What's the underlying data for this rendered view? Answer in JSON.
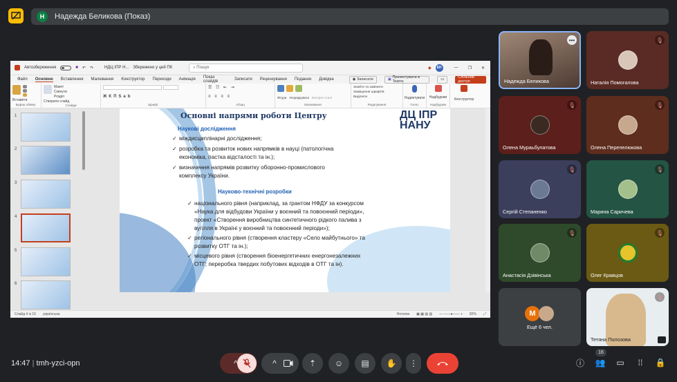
{
  "presenter": {
    "initial": "Н",
    "label": "Надежда Беликова (Показ)"
  },
  "ppt": {
    "autosave_label": "Автозбереження",
    "doc_name": "НДЦ ІПР Н...",
    "saved_label": "Збережено у цей ПК",
    "search_placeholder": "Пошук",
    "user_initials": "ЕН",
    "menu": [
      "Файл",
      "Основне",
      "Вставлення",
      "Малювання",
      "Конструктор",
      "Переходи",
      "Анімація",
      "Показ слайдів",
      "Записати",
      "Рецензування",
      "Подання",
      "Довідка"
    ],
    "record_btn": "Записати",
    "teams_btn": "Презентувати в Teams",
    "share_btn": "Спільний доступ",
    "ribbon": {
      "paste": "Вставити",
      "clipboard": "Буфер обміну",
      "new_slide": "Створити слайд",
      "slides": "Слайди",
      "layout": "Макет",
      "reset": "Скинути",
      "section": "Розділ",
      "font": "Шрифт",
      "paragraph": "Абзац",
      "shapes": "Фігури",
      "arrange": "Упорядкувати",
      "quick_styles": "Експрес-стилі",
      "drawing": "Малювання",
      "find": "Знайти та замінити",
      "replace_fonts": "Заміщення шрифтів",
      "select": "Виділити",
      "editing": "Редагування",
      "dictate": "Надиктувати",
      "voice": "Голос",
      "addins": "Надбудови",
      "addins_group": "Надбудови",
      "designer": "Конструктор"
    },
    "thumb_numbers": [
      "1",
      "2",
      "3",
      "4",
      "5",
      "6"
    ],
    "status": {
      "slide": "Слайд 4 із 16",
      "lang": "українська",
      "notes": "Нотатки",
      "zoom": "82%"
    }
  },
  "slide": {
    "title": "Основні напрями роботи Центру",
    "logo_line1": "ДЦ ІПР",
    "logo_line2": "НАНУ",
    "section1": "Наукові дослідження",
    "s1_items": [
      "міждисциплінарні дослідження;",
      "розробка та розвиток нових напрямків в науці (патологічна",
      "економіка, пастка відсталості та ін.);",
      "визначення   напрямів   розвитку   оборонно-промислового",
      "комплексу України."
    ],
    "section2": "Науково-технічні розробки",
    "s2_items": [
      "національного рівня (наприклад, за грантом НФДУ за конкурсом",
      "«Наука для відбудови України у воєнний та повоєнний періоди»,",
      "проект «Створення виробництва синтетичного рідкого палива з",
      "вугілля в Україні у воєнний та повоєнний періоди»);",
      "регіонального рівня (створення кластеру «Село майбутнього» та",
      "розвитку ОТГ та ін.);",
      "місцевого рівня (створення біоенергетичних енергонезалежних",
      "ОТГ; переробка твердих побутових відходів в ОТГ та ін)."
    ]
  },
  "participants": [
    {
      "name": "Надежда Беликова",
      "muted": false
    },
    {
      "name": "Наталія Помогалова",
      "muted": true
    },
    {
      "name": "Олена Мураьбулатова",
      "muted": true
    },
    {
      "name": "Олена Перепелюкова",
      "muted": true
    },
    {
      "name": "Сергій Степаненко",
      "muted": true
    },
    {
      "name": "Марина Саричева",
      "muted": true
    },
    {
      "name": "Анастасія Дзівінська",
      "muted": true
    },
    {
      "name": "Олег Кравцов",
      "muted": true
    },
    {
      "name": "Ещё 6 чел.",
      "muted": false
    },
    {
      "name": "Тетяна Полозова",
      "muted": true
    }
  ],
  "more_initial": "М",
  "bottom": {
    "time": "14:47",
    "meeting_code": "tmh-yzci-opn",
    "participant_count": "16"
  },
  "colors": {
    "accent_red": "#ea4335",
    "present_yellow": "#fbbc04",
    "ppt_orange": "#c43e1c"
  }
}
